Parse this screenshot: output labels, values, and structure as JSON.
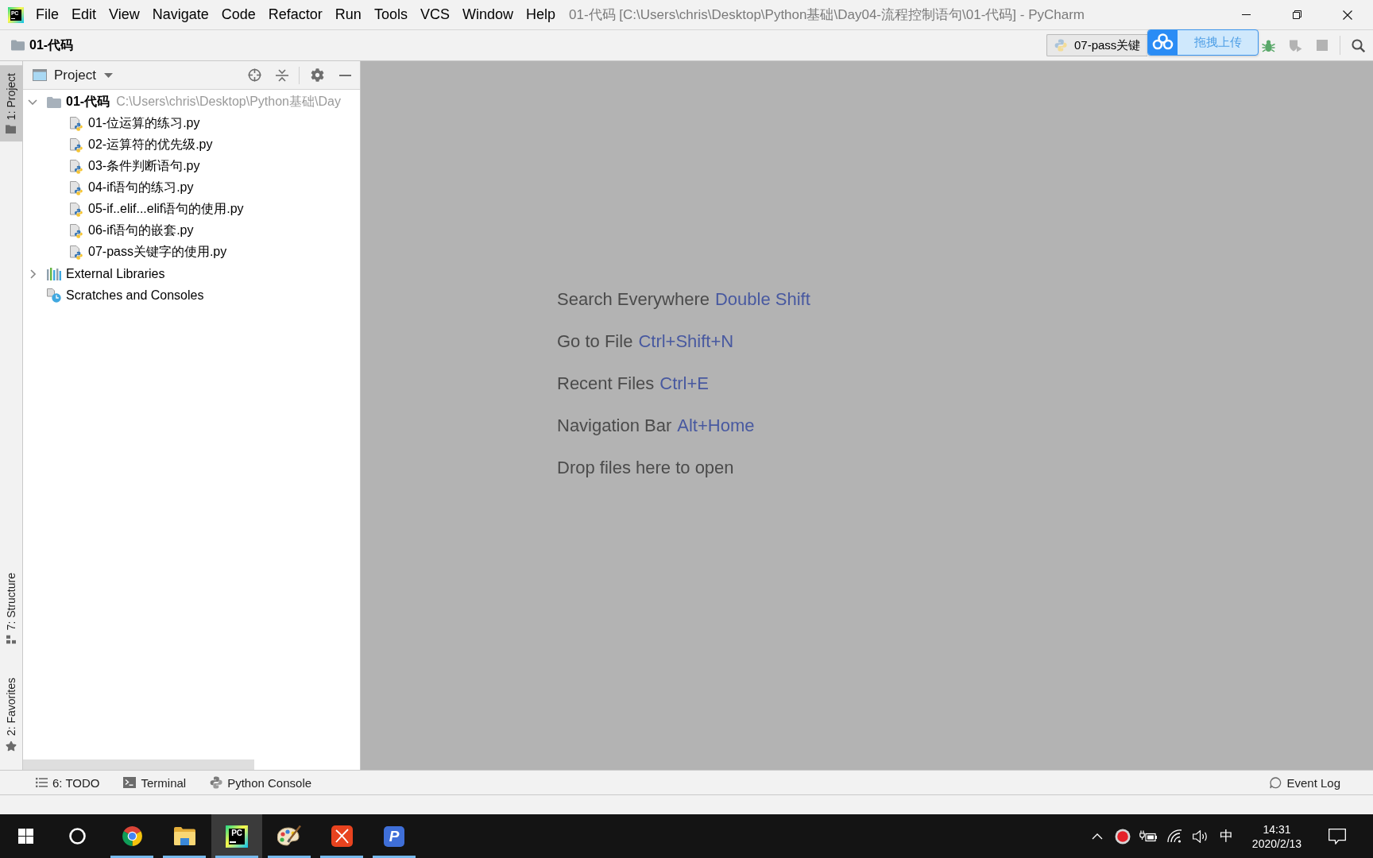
{
  "window": {
    "title": "01-代码 [C:\\Users\\chris\\Desktop\\Python基础\\Day04-流程控制语句\\01-代码] - PyCharm",
    "logo_text": "PC"
  },
  "menu": [
    {
      "label": "File"
    },
    {
      "label": "Edit"
    },
    {
      "label": "View"
    },
    {
      "label": "Navigate"
    },
    {
      "label": "Code"
    },
    {
      "label": "Refactor"
    },
    {
      "label": "Run"
    },
    {
      "label": "Tools"
    },
    {
      "label": "VCS"
    },
    {
      "label": "Window"
    },
    {
      "label": "Help"
    }
  ],
  "navigation_bar": {
    "breadcrumb": "01-代码",
    "run_configuration": "07-pass关键",
    "run_controls": {
      "debug": {
        "disabled": false
      },
      "coverage": {
        "disabled": true
      },
      "stop": {
        "disabled": true
      }
    }
  },
  "upload_widget": {
    "label": "拖拽上传"
  },
  "tool_windows_left": {
    "top": [
      {
        "kind": "project",
        "label": "1: Project",
        "selected": true
      }
    ],
    "bottom": [
      {
        "kind": "structure",
        "label": "7: Structure",
        "selected": false
      },
      {
        "kind": "favorites",
        "label": "2: Favorites",
        "selected": false
      }
    ]
  },
  "project_panel": {
    "title": "Project",
    "tree": [
      {
        "kind": "project-root",
        "label": "01-代码",
        "path": "C:\\Users\\chris\\Desktop\\Python基础\\Day",
        "expanded": true,
        "children": [
          {
            "kind": "python-file",
            "label": "01-位运算的练习.py"
          },
          {
            "kind": "python-file",
            "label": "02-运算符的优先级.py"
          },
          {
            "kind": "python-file",
            "label": "03-条件判断语句.py"
          },
          {
            "kind": "python-file",
            "label": "04-if语句的练习.py"
          },
          {
            "kind": "python-file",
            "label": "05-if..elif...elif语句的使用.py"
          },
          {
            "kind": "python-file",
            "label": "06-if语句的嵌套.py"
          },
          {
            "kind": "python-file",
            "label": "07-pass关键字的使用.py"
          }
        ]
      },
      {
        "kind": "libraries",
        "label": "External Libraries",
        "expanded": false
      },
      {
        "kind": "scratches",
        "label": "Scratches and Consoles"
      }
    ]
  },
  "editor": {
    "hints": [
      {
        "action": "Search Everywhere",
        "shortcut": "Double Shift"
      },
      {
        "action": "Go to File",
        "shortcut": "Ctrl+Shift+N"
      },
      {
        "action": "Recent Files",
        "shortcut": "Ctrl+E"
      },
      {
        "action": "Navigation Bar",
        "shortcut": "Alt+Home"
      },
      {
        "action": "Drop files here to open"
      }
    ]
  },
  "bottom_tool_windows": [
    {
      "kind": "todo",
      "label": "6: TODO",
      "selected": false
    },
    {
      "kind": "terminal",
      "label": "Terminal",
      "selected": false
    },
    {
      "kind": "python-console",
      "label": "Python Console",
      "selected": false
    }
  ],
  "event_log": {
    "label": "Event Log"
  },
  "taskbar": {
    "apps": [
      {
        "kind": "browser",
        "selected": false,
        "running": true
      },
      {
        "kind": "files",
        "selected": false,
        "running": true
      },
      {
        "kind": "pycharm",
        "label": "PC",
        "selected": true,
        "running": true
      },
      {
        "kind": "paint",
        "selected": false,
        "running": true
      },
      {
        "kind": "red-x",
        "selected": false,
        "running": true
      },
      {
        "kind": "blue-p",
        "label": "P",
        "selected": false,
        "running": true
      }
    ],
    "input_method": "中",
    "clock": {
      "time": "14:31",
      "date": "2020/2/13"
    }
  }
}
